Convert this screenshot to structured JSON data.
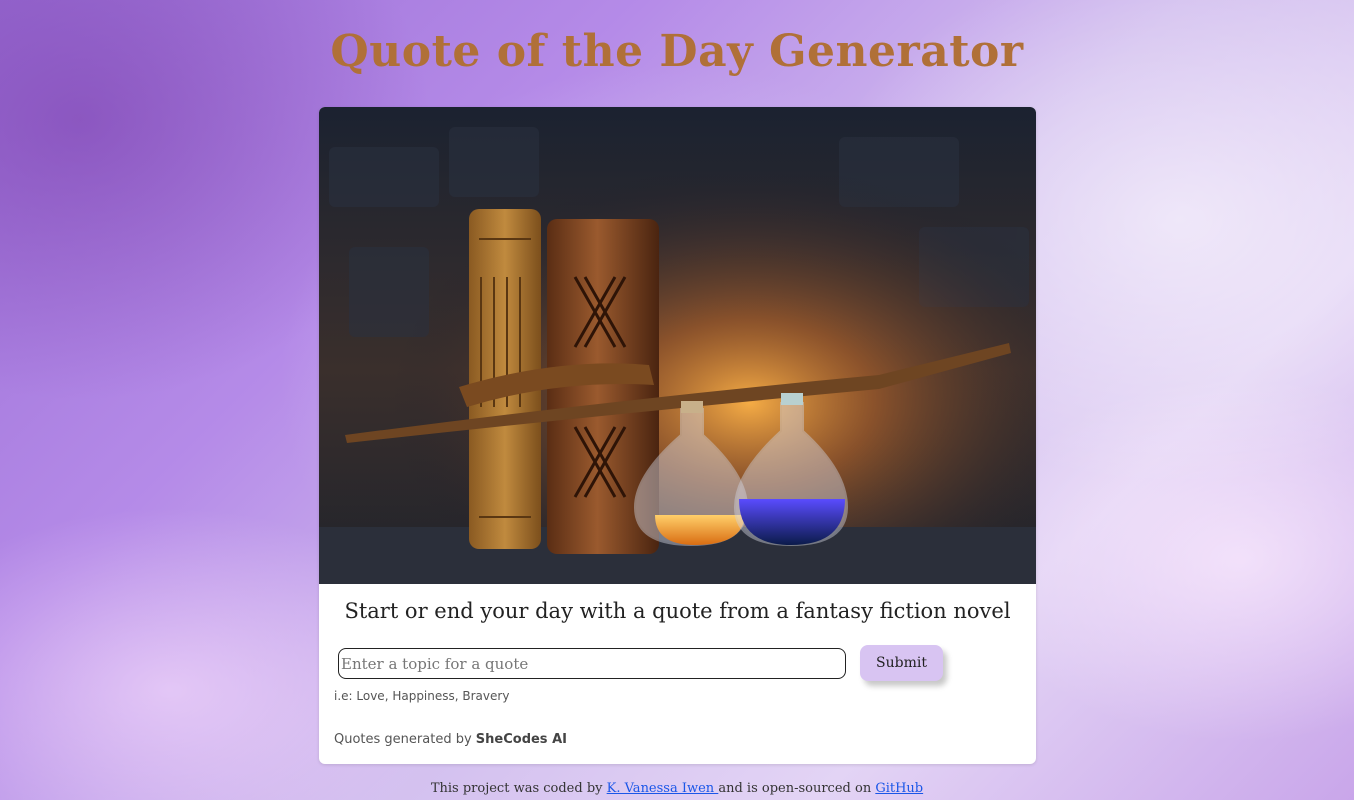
{
  "header": {
    "title": "Quote of the Day Generator"
  },
  "hero": {
    "description": "Leather-bound books, a wooden wand and two potion bottles"
  },
  "main": {
    "tagline": "Start or end your day with a quote from a fantasy fiction novel",
    "search": {
      "placeholder": "Enter a topic for a quote",
      "value": ""
    },
    "submit_label": "Submit",
    "hint": "i.e: Love, Happiness, Bravery",
    "credit_prefix": "Quotes generated by ",
    "credit_brand": "SheCodes AI"
  },
  "footer": {
    "prefix": "This project was coded by ",
    "author": "K. Vanessa Iwen ",
    "middle": "and is open-sourced on ",
    "repo": "GitHub"
  },
  "colors": {
    "title": "#b07038",
    "button": "#d8c4f2",
    "link": "#1a56e8"
  }
}
